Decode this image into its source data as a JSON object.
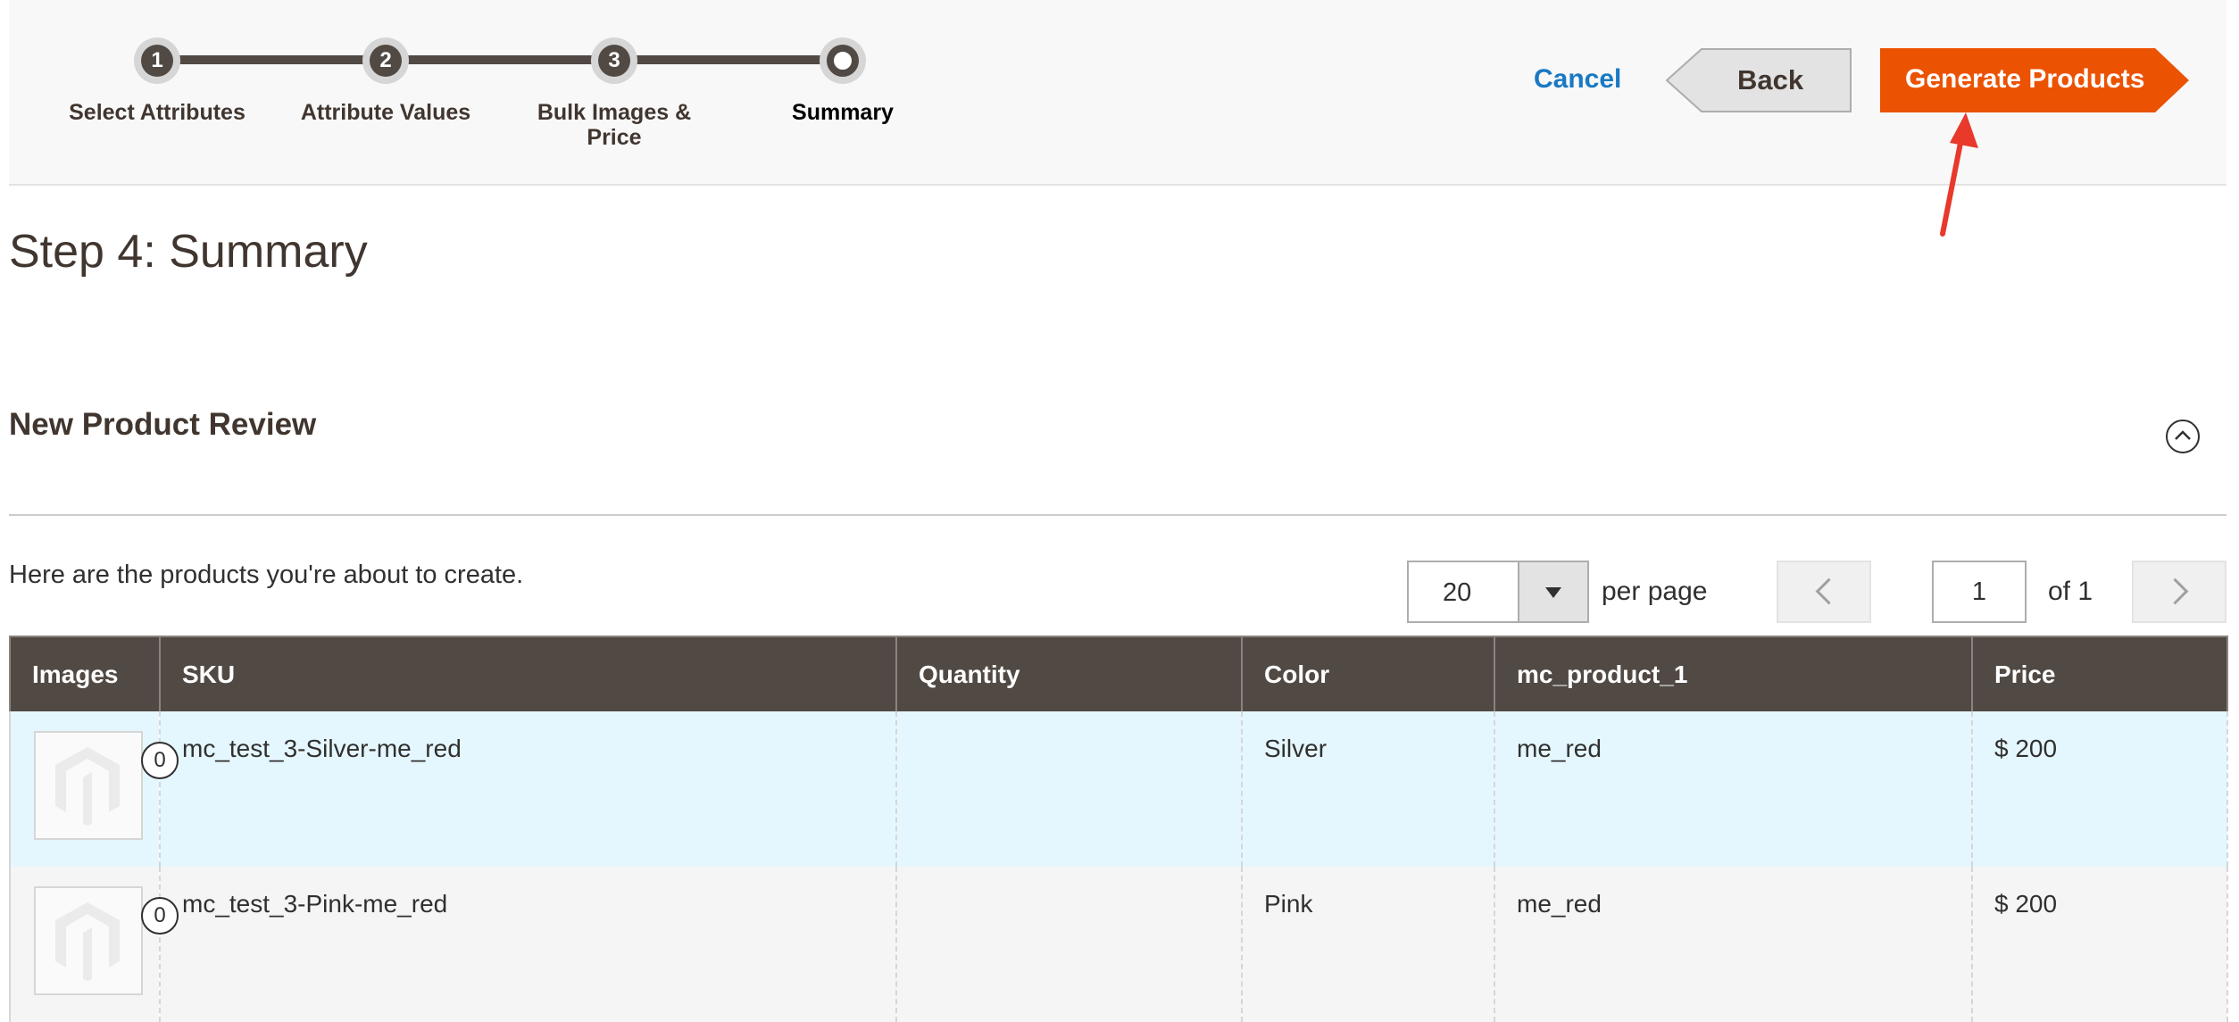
{
  "wizard": {
    "steps": [
      {
        "number": "1",
        "label": "Select Attributes"
      },
      {
        "number": "2",
        "label": "Attribute Values"
      },
      {
        "number": "3",
        "label": "Bulk Images & Price"
      },
      {
        "number": "",
        "label": "Summary"
      }
    ],
    "cancel_label": "Cancel",
    "back_label": "Back",
    "generate_label": "Generate Products"
  },
  "page_title": "Step 4: Summary",
  "section": {
    "title": "New Product Review",
    "intro": "Here are the products you're about to create."
  },
  "pager": {
    "per_page_value": "20",
    "per_page_label": "per page",
    "current_page": "1",
    "of_label": "of 1"
  },
  "table": {
    "headers": [
      "Images",
      "SKU",
      "Quantity",
      "Color",
      "mc_product_1",
      "Price"
    ],
    "rows": [
      {
        "image_count": "0",
        "sku": "mc_test_3-Silver-me_red",
        "quantity": "",
        "color": "Silver",
        "attr": "me_red",
        "price": "$ 200"
      },
      {
        "image_count": "0",
        "sku": "mc_test_3-Pink-me_red",
        "quantity": "",
        "color": "Pink",
        "attr": "me_red",
        "price": "$ 200"
      }
    ]
  },
  "colors": {
    "accent": "#eb5202",
    "link": "#1979c3",
    "header_bg": "#514943",
    "highlight_row": "#e5f7fe"
  },
  "icons": [
    "collapse-up-icon",
    "chevron-down-icon",
    "chevron-left-icon",
    "chevron-right-icon",
    "magento-placeholder-icon",
    "annotation-arrow-icon"
  ]
}
